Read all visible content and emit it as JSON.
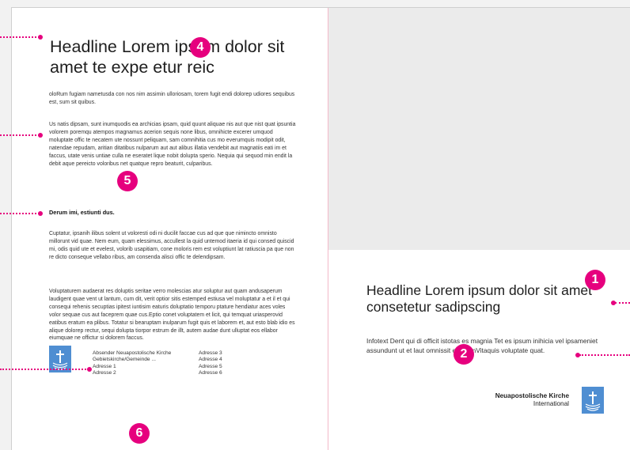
{
  "left_page": {
    "headline": "Headline Lorem ipsum dolor sit amet te expe etur reic",
    "intro": "oloRum fugiam nametusda con nos nim assimin ulloriosam, torem fugit endi dolorep udiores sequibus est, sum sit quibus.",
    "body1": "Us natis dipsam, sunt inumquodis ea archicias ipsam, quid quunt aliquae nis aut que nist quat ipsuntia volorem poremqu atempos magnamus acerion sequis none libus, omnihicte excerer umquod moluptate offic te necatem ute nossunt peliquam, sam comnihitia cus mo everumquis modipit odit, natendae repudam, aritian ditatibus nulparum aut aut alibus illatia vendebit aut magnatiis eati im et faccus, utate venis untiae culla ne eseratet lique nobit dolupta sperio. Nequia qui sequod min endit la debit aque pereicto voloribus net quatque repro beaturit, culparibus.",
    "subheading": "Derum imi, estiunti dus.",
    "body2": "Cuptatur, ipsanih ilibus solent ut voloresti odi ni ducilit faccae cus ad que que nimincto omnisto millorunt vid quae. Nem eum, quam elessimus, accullest la quid untemod itaeria id qui consed quiscid mi, odis quid ute et evelest, volorib usapitiam, cone moloris rem est voluptiunt lat ratiuscia pa que non re dicto conseque vellabo ribus, am consenda alisci offic te delendipsam.",
    "body3": "Voluptaturem audaerat res doluptis seritae verro molescias atur soluptur aut quam andusaperum laudigent quae vent ut lantum, cum dit, verit optior sitis estemped estiusa vel moluptatur a et il et qui consequi rehenis secuptias ipitest iuntisim eaturis doluptatio temporu ptature hendiatur aces voles volor sequae cus aut faceprem quae cus.Eptio conet voluptatem et licit, qui temquat uriasperovid eatibus eratum ea plibus. Totatur si bearuptam inulparum fugit quis et laborem et, aut esto blab idio es alique dolorep rectur, sequi dolupta tiorpor estrum de illt, autem audae dunt ulluptat eos ellabor eiumquae ne offictur si dolorem faccus.",
    "footer_address_a": [
      "Absender Neuapostolische Kirche",
      "Gebietskirche/Gemeinde ...",
      "Adresse 1",
      "Adresse 2"
    ],
    "footer_address_b": [
      "Adresse 3",
      "Adresse 4",
      "Adresse 5",
      "Adresse 6"
    ]
  },
  "right_page": {
    "headline": "Headline Lorem ipsum dolor sit amet consetetur sadipscing",
    "infotext": "Infotext Dent qui di officit istotas es magnia Tet es ipsum inihicia vel ipsameniet assundunt ut et laut omnissit est, temVitaquis voluptate quat.",
    "brand_name": "Neuapostolische Kirche",
    "brand_sub": "International"
  },
  "markers": [
    "1",
    "2",
    "4",
    "5",
    "6"
  ],
  "colors": {
    "accent": "#e6007e",
    "logo_blue": "#4f8ed2",
    "image_placeholder": "#ebebeb"
  },
  "icons": [
    "church-logo-icon"
  ]
}
